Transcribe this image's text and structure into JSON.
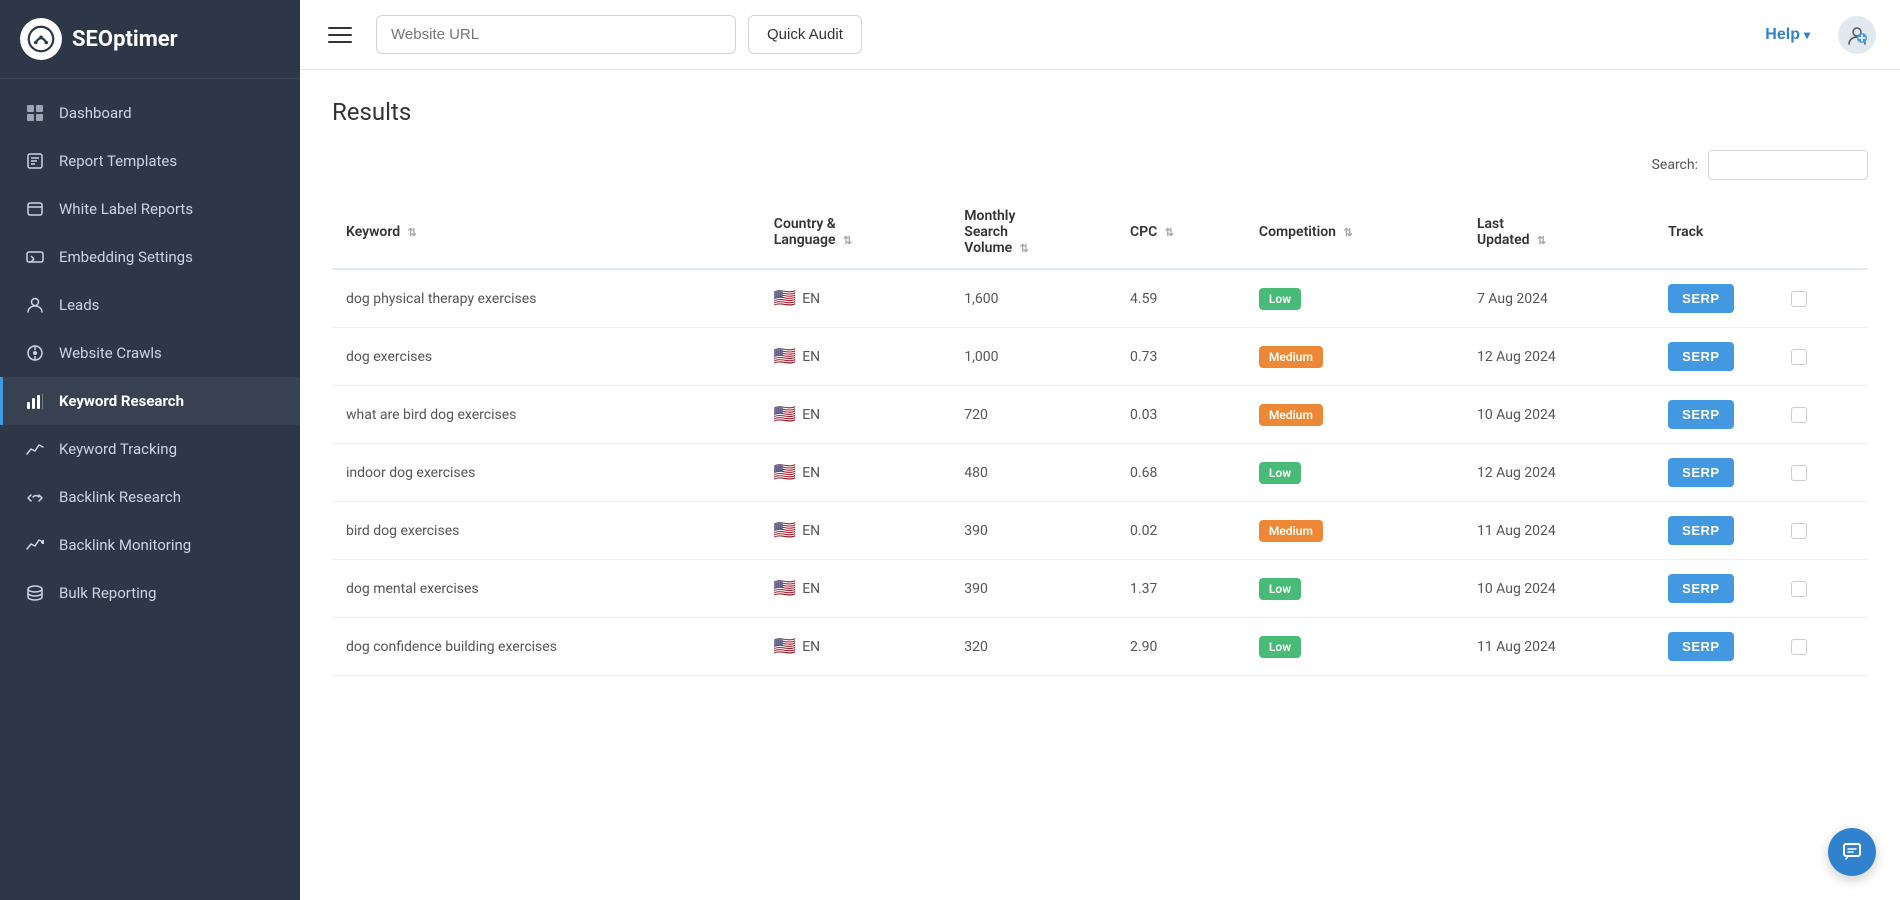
{
  "brand": {
    "name": "SEOptimer"
  },
  "sidebar": {
    "items": [
      {
        "id": "dashboard",
        "label": "Dashboard",
        "icon": "dashboard-icon",
        "active": false
      },
      {
        "id": "report-templates",
        "label": "Report Templates",
        "icon": "report-templates-icon",
        "active": false
      },
      {
        "id": "white-label-reports",
        "label": "White Label Reports",
        "icon": "white-label-icon",
        "active": false
      },
      {
        "id": "embedding-settings",
        "label": "Embedding Settings",
        "icon": "embedding-icon",
        "active": false
      },
      {
        "id": "leads",
        "label": "Leads",
        "icon": "leads-icon",
        "active": false
      },
      {
        "id": "website-crawls",
        "label": "Website Crawls",
        "icon": "crawls-icon",
        "active": false
      },
      {
        "id": "keyword-research",
        "label": "Keyword Research",
        "icon": "keyword-research-icon",
        "active": true
      },
      {
        "id": "keyword-tracking",
        "label": "Keyword Tracking",
        "icon": "keyword-tracking-icon",
        "active": false
      },
      {
        "id": "backlink-research",
        "label": "Backlink Research",
        "icon": "backlink-research-icon",
        "active": false
      },
      {
        "id": "backlink-monitoring",
        "label": "Backlink Monitoring",
        "icon": "backlink-monitoring-icon",
        "active": false
      },
      {
        "id": "bulk-reporting",
        "label": "Bulk Reporting",
        "icon": "bulk-reporting-icon",
        "active": false
      }
    ]
  },
  "header": {
    "url_placeholder": "Website URL",
    "quick_audit_label": "Quick Audit",
    "help_label": "Help",
    "hamburger_label": "Menu"
  },
  "search": {
    "label": "Search:",
    "placeholder": ""
  },
  "results": {
    "title": "Results",
    "columns": [
      {
        "id": "keyword",
        "label": "Keyword",
        "sortable": true
      },
      {
        "id": "country-language",
        "label": "Country & Language",
        "sortable": true
      },
      {
        "id": "monthly-search-volume",
        "label": "Monthly Search Volume",
        "sortable": true
      },
      {
        "id": "cpc",
        "label": "CPC",
        "sortable": true
      },
      {
        "id": "competition",
        "label": "Competition",
        "sortable": true
      },
      {
        "id": "last-updated",
        "label": "Last Updated",
        "sortable": true
      },
      {
        "id": "track",
        "label": "Track",
        "sortable": false
      }
    ],
    "rows": [
      {
        "keyword": "dog physical therapy exercises",
        "country": "EN",
        "flag": "🇺🇸",
        "monthly_volume": "1,600",
        "cpc": "4.59",
        "competition": "Low",
        "competition_class": "low",
        "last_updated": "7 Aug 2024",
        "serp_label": "SERP"
      },
      {
        "keyword": "dog exercises",
        "country": "EN",
        "flag": "🇺🇸",
        "monthly_volume": "1,000",
        "cpc": "0.73",
        "competition": "Medium",
        "competition_class": "medium",
        "last_updated": "12 Aug 2024",
        "serp_label": "SERP"
      },
      {
        "keyword": "what are bird dog exercises",
        "country": "EN",
        "flag": "🇺🇸",
        "monthly_volume": "720",
        "cpc": "0.03",
        "competition": "Medium",
        "competition_class": "medium",
        "last_updated": "10 Aug 2024",
        "serp_label": "SERP"
      },
      {
        "keyword": "indoor dog exercises",
        "country": "EN",
        "flag": "🇺🇸",
        "monthly_volume": "480",
        "cpc": "0.68",
        "competition": "Low",
        "competition_class": "low",
        "last_updated": "12 Aug 2024",
        "serp_label": "SERP"
      },
      {
        "keyword": "bird dog exercises",
        "country": "EN",
        "flag": "🇺🇸",
        "monthly_volume": "390",
        "cpc": "0.02",
        "competition": "Medium",
        "competition_class": "medium",
        "last_updated": "11 Aug 2024",
        "serp_label": "SERP"
      },
      {
        "keyword": "dog mental exercises",
        "country": "EN",
        "flag": "🇺🇸",
        "monthly_volume": "390",
        "cpc": "1.37",
        "competition": "Low",
        "competition_class": "low",
        "last_updated": "10 Aug 2024",
        "serp_label": "SERP"
      },
      {
        "keyword": "dog confidence building exercises",
        "country": "EN",
        "flag": "🇺🇸",
        "monthly_volume": "320",
        "cpc": "2.90",
        "competition": "Low",
        "competition_class": "low",
        "last_updated": "11 Aug 2024",
        "serp_label": "SERP"
      }
    ]
  }
}
